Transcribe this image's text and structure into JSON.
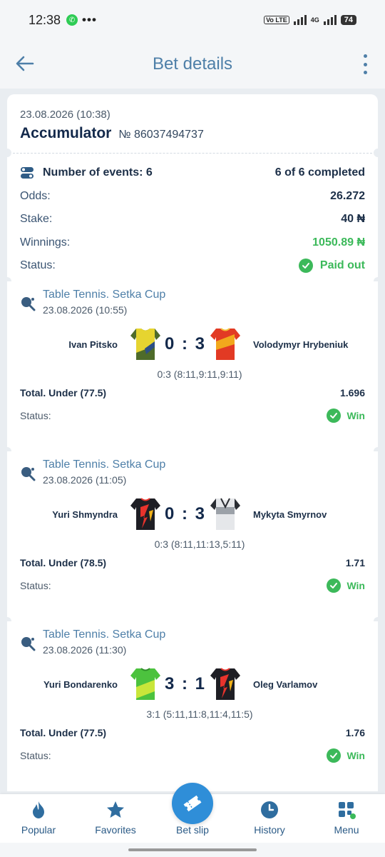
{
  "status_bar": {
    "time": "12:38",
    "dots": "•••",
    "volte": "Vo LTE",
    "network": "4G",
    "battery": "74"
  },
  "app_bar": {
    "title": "Bet details"
  },
  "bet": {
    "datetime": "23.08.2026 (10:38)",
    "type": "Accumulator",
    "number": "№ 86037494737"
  },
  "summary": {
    "events_label": "Number of events: 6",
    "events_completed": "6 of 6 completed",
    "odds_label": "Odds:",
    "odds_value": "26.272",
    "stake_label": "Stake:",
    "stake_value": "40 ₦",
    "winnings_label": "Winnings:",
    "winnings_value": "1050.89 ₦",
    "status_label": "Status:",
    "status_value": "Paid out"
  },
  "events": [
    {
      "league": "Table Tennis. Setka Cup",
      "datetime": "23.08.2026 (10:55)",
      "player1": "Ivan Pitsko",
      "player2": "Volodymyr Hrybeniuk",
      "score": "0 : 3",
      "sets": "0:3 (8:11,9:11,9:11)",
      "market": "Total. Under (77.5)",
      "odds": "1.696",
      "status_label": "Status:",
      "result": "Win"
    },
    {
      "league": "Table Tennis. Setka Cup",
      "datetime": "23.08.2026 (11:05)",
      "player1": "Yuri Shmyndra",
      "player2": "Mykyta Smyrnov",
      "score": "0 : 3",
      "sets": "0:3 (8:11,11:13,5:11)",
      "market": "Total. Under (78.5)",
      "odds": "1.71",
      "status_label": "Status:",
      "result": "Win"
    },
    {
      "league": "Table Tennis. Setka Cup",
      "datetime": "23.08.2026 (11:30)",
      "player1": "Yuri  Bondarenko",
      "player2": "Oleg Varlamov",
      "score": "3 : 1",
      "sets": "3:1 (5:11,11:8,11:4,11:5)",
      "market": "Total. Under (77.5)",
      "odds": "1.76",
      "status_label": "Status:",
      "result": "Win"
    }
  ],
  "bottom_nav": {
    "popular": "Popular",
    "favorites": "Favorites",
    "bet_slip": "Bet slip",
    "history": "History",
    "menu": "Menu"
  },
  "colors": {
    "accent": "#2f8ed8",
    "win_green": "#3cb95a",
    "title_blue": "#4e7fa8",
    "background": "#e9edf1"
  }
}
